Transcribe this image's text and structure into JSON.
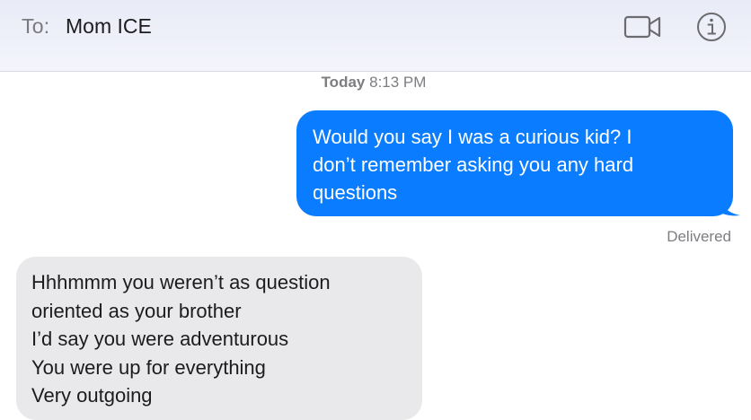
{
  "header": {
    "to_label": "To:",
    "recipient": "Mom ICE",
    "video_icon": "video-camera-icon",
    "info_icon": "info-icon"
  },
  "conversation": {
    "timestamp_day": "Today",
    "timestamp_time": "8:13 PM",
    "messages": [
      {
        "direction": "sent",
        "lines": [
          "Would you say I was a curious kid? I",
          "don’t remember asking you any hard",
          "questions"
        ],
        "status": "Delivered"
      },
      {
        "direction": "received",
        "lines": [
          "Hhhmmm you weren’t as question",
          "oriented as your brother",
          "I’d say you were adventurous",
          "You were up for everything",
          "Very outgoing"
        ]
      }
    ]
  },
  "colors": {
    "sent_bubble": "#0a7cff",
    "received_bubble": "#e9e9eb",
    "header_bg": "#e9ebf7",
    "meta_text": "#7d7d82"
  }
}
